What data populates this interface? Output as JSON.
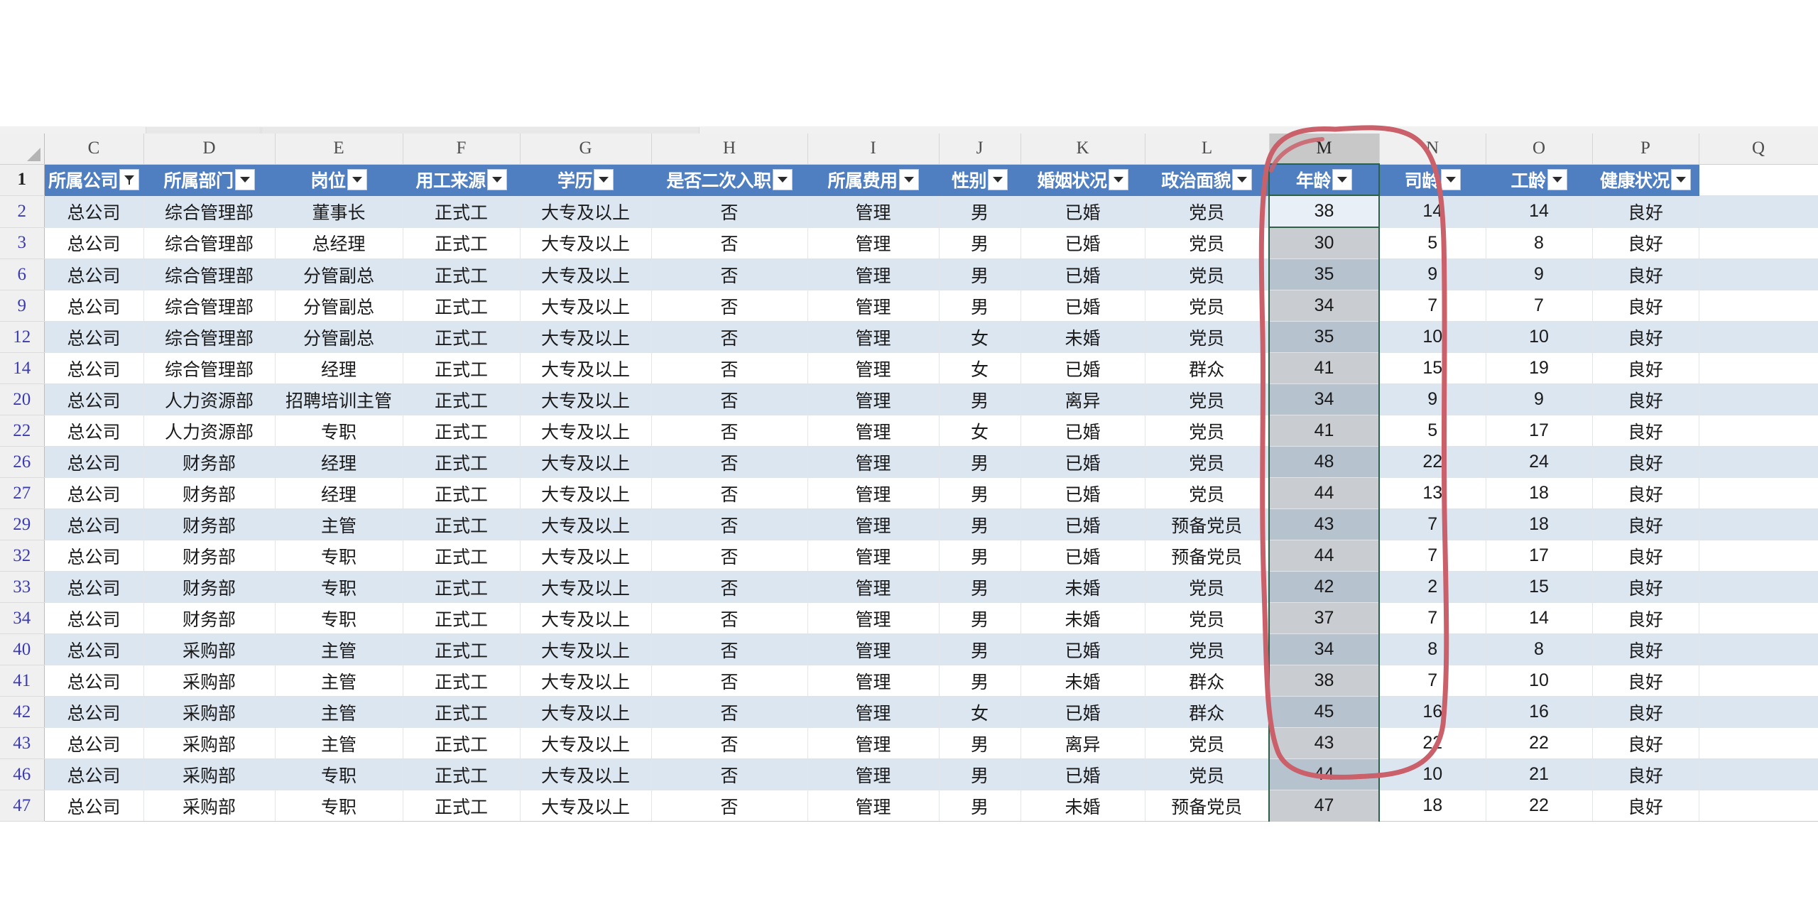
{
  "app": {
    "type": "spreadsheet",
    "sheet_area_top_blank": true
  },
  "column_letters": [
    "C",
    "D",
    "E",
    "F",
    "G",
    "H",
    "I",
    "J",
    "K",
    "L",
    "M",
    "N",
    "O",
    "P",
    "Q"
  ],
  "selected_column_letter": "M",
  "active_cell": "M2",
  "row_numbers": [
    "1",
    "2",
    "3",
    "6",
    "9",
    "12",
    "14",
    "20",
    "22",
    "26",
    "27",
    "29",
    "32",
    "33",
    "34",
    "40",
    "41",
    "42",
    "43",
    "46",
    "47"
  ],
  "headers": [
    {
      "letter": "C",
      "label": "所属公司",
      "filter_icon": "funnel-icon",
      "filtered": true
    },
    {
      "letter": "D",
      "label": "所属部门",
      "filter_icon": "chevron-down-icon",
      "filtered": false
    },
    {
      "letter": "E",
      "label": "岗位",
      "filter_icon": "chevron-down-icon",
      "filtered": false
    },
    {
      "letter": "F",
      "label": "用工来源",
      "filter_icon": "chevron-down-icon",
      "filtered": false
    },
    {
      "letter": "G",
      "label": "学历",
      "filter_icon": "chevron-down-icon",
      "filtered": false
    },
    {
      "letter": "H",
      "label": "是否二次入职",
      "filter_icon": "chevron-down-icon",
      "filtered": false
    },
    {
      "letter": "I",
      "label": "所属费用",
      "filter_icon": "chevron-down-icon",
      "filtered": false
    },
    {
      "letter": "J",
      "label": "性别",
      "filter_icon": "chevron-down-icon",
      "filtered": false
    },
    {
      "letter": "K",
      "label": "婚姻状况",
      "filter_icon": "chevron-down-icon",
      "filtered": false
    },
    {
      "letter": "L",
      "label": "政治面貌",
      "filter_icon": "chevron-down-icon",
      "filtered": false
    },
    {
      "letter": "M",
      "label": "年龄",
      "filter_icon": "chevron-down-icon",
      "filtered": false
    },
    {
      "letter": "N",
      "label": "司龄",
      "filter_icon": "chevron-down-icon",
      "filtered": false
    },
    {
      "letter": "O",
      "label": "工龄",
      "filter_icon": "chevron-down-icon",
      "filtered": false
    },
    {
      "letter": "P",
      "label": "健康状况",
      "filter_icon": "chevron-down-icon",
      "filtered": false
    }
  ],
  "rows": [
    {
      "num": "2",
      "cells": [
        "总公司",
        "综合管理部",
        "董事长",
        "正式工",
        "大专及以上",
        "否",
        "管理",
        "男",
        "已婚",
        "党员",
        "38",
        "14",
        "14",
        "良好"
      ]
    },
    {
      "num": "3",
      "cells": [
        "总公司",
        "综合管理部",
        "总经理",
        "正式工",
        "大专及以上",
        "否",
        "管理",
        "男",
        "已婚",
        "党员",
        "30",
        "5",
        "8",
        "良好"
      ]
    },
    {
      "num": "6",
      "cells": [
        "总公司",
        "综合管理部",
        "分管副总",
        "正式工",
        "大专及以上",
        "否",
        "管理",
        "男",
        "已婚",
        "党员",
        "35",
        "9",
        "9",
        "良好"
      ]
    },
    {
      "num": "9",
      "cells": [
        "总公司",
        "综合管理部",
        "分管副总",
        "正式工",
        "大专及以上",
        "否",
        "管理",
        "男",
        "已婚",
        "党员",
        "34",
        "7",
        "7",
        "良好"
      ]
    },
    {
      "num": "12",
      "cells": [
        "总公司",
        "综合管理部",
        "分管副总",
        "正式工",
        "大专及以上",
        "否",
        "管理",
        "女",
        "未婚",
        "党员",
        "35",
        "10",
        "10",
        "良好"
      ]
    },
    {
      "num": "14",
      "cells": [
        "总公司",
        "综合管理部",
        "经理",
        "正式工",
        "大专及以上",
        "否",
        "管理",
        "女",
        "已婚",
        "群众",
        "41",
        "15",
        "19",
        "良好"
      ]
    },
    {
      "num": "20",
      "cells": [
        "总公司",
        "人力资源部",
        "招聘培训主管",
        "正式工",
        "大专及以上",
        "否",
        "管理",
        "男",
        "离异",
        "党员",
        "34",
        "9",
        "9",
        "良好"
      ]
    },
    {
      "num": "22",
      "cells": [
        "总公司",
        "人力资源部",
        "专职",
        "正式工",
        "大专及以上",
        "否",
        "管理",
        "女",
        "已婚",
        "党员",
        "41",
        "5",
        "17",
        "良好"
      ]
    },
    {
      "num": "26",
      "cells": [
        "总公司",
        "财务部",
        "经理",
        "正式工",
        "大专及以上",
        "否",
        "管理",
        "男",
        "已婚",
        "党员",
        "48",
        "22",
        "24",
        "良好"
      ]
    },
    {
      "num": "27",
      "cells": [
        "总公司",
        "财务部",
        "经理",
        "正式工",
        "大专及以上",
        "否",
        "管理",
        "男",
        "已婚",
        "党员",
        "44",
        "13",
        "18",
        "良好"
      ]
    },
    {
      "num": "29",
      "cells": [
        "总公司",
        "财务部",
        "主管",
        "正式工",
        "大专及以上",
        "否",
        "管理",
        "男",
        "已婚",
        "预备党员",
        "43",
        "7",
        "18",
        "良好"
      ]
    },
    {
      "num": "32",
      "cells": [
        "总公司",
        "财务部",
        "专职",
        "正式工",
        "大专及以上",
        "否",
        "管理",
        "男",
        "已婚",
        "预备党员",
        "44",
        "7",
        "17",
        "良好"
      ]
    },
    {
      "num": "33",
      "cells": [
        "总公司",
        "财务部",
        "专职",
        "正式工",
        "大专及以上",
        "否",
        "管理",
        "男",
        "未婚",
        "党员",
        "42",
        "2",
        "15",
        "良好"
      ]
    },
    {
      "num": "34",
      "cells": [
        "总公司",
        "财务部",
        "专职",
        "正式工",
        "大专及以上",
        "否",
        "管理",
        "男",
        "未婚",
        "党员",
        "37",
        "7",
        "14",
        "良好"
      ]
    },
    {
      "num": "40",
      "cells": [
        "总公司",
        "采购部",
        "主管",
        "正式工",
        "大专及以上",
        "否",
        "管理",
        "男",
        "已婚",
        "党员",
        "34",
        "8",
        "8",
        "良好"
      ]
    },
    {
      "num": "41",
      "cells": [
        "总公司",
        "采购部",
        "主管",
        "正式工",
        "大专及以上",
        "否",
        "管理",
        "男",
        "未婚",
        "群众",
        "38",
        "7",
        "10",
        "良好"
      ]
    },
    {
      "num": "42",
      "cells": [
        "总公司",
        "采购部",
        "主管",
        "正式工",
        "大专及以上",
        "否",
        "管理",
        "女",
        "已婚",
        "群众",
        "45",
        "16",
        "16",
        "良好"
      ]
    },
    {
      "num": "43",
      "cells": [
        "总公司",
        "采购部",
        "主管",
        "正式工",
        "大专及以上",
        "否",
        "管理",
        "男",
        "离异",
        "党员",
        "43",
        "22",
        "22",
        "良好"
      ]
    },
    {
      "num": "46",
      "cells": [
        "总公司",
        "采购部",
        "专职",
        "正式工",
        "大专及以上",
        "否",
        "管理",
        "男",
        "已婚",
        "党员",
        "44",
        "10",
        "21",
        "良好"
      ]
    },
    {
      "num": "47",
      "cells": [
        "总公司",
        "采购部",
        "专职",
        "正式工",
        "大专及以上",
        "否",
        "管理",
        "男",
        "未婚",
        "预备党员",
        "47",
        "18",
        "22",
        "良好"
      ]
    }
  ],
  "annotation": {
    "shape": "hand-drawn-ellipse",
    "color": "#c9606a",
    "targets_column": "M"
  },
  "colors": {
    "header_blue": "#4f7fc0",
    "band_blue": "#dce6f1",
    "selection_green": "#2c6148",
    "annotation_red": "#c9606a"
  }
}
